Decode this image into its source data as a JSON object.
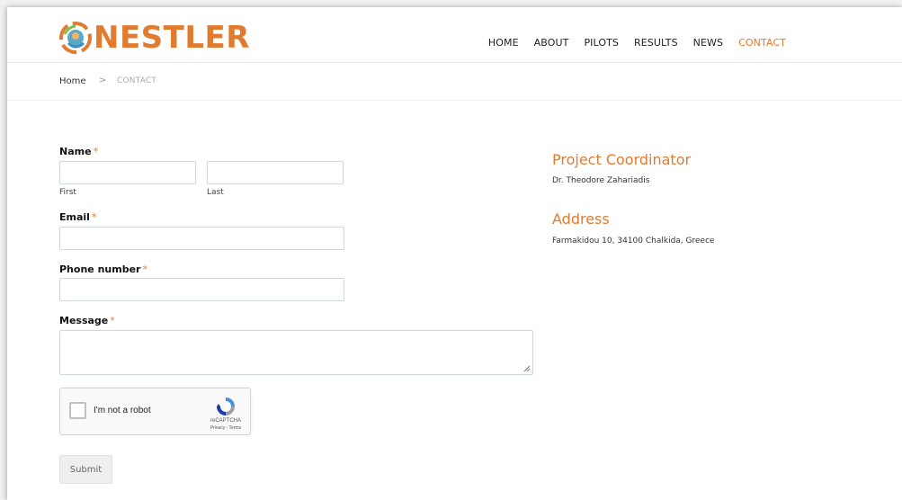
{
  "brand": {
    "name": "NESTLER",
    "logo_icon": "nestler-logo-icon",
    "accent_color": "#e07b2f"
  },
  "nav": {
    "items": [
      {
        "label": "HOME"
      },
      {
        "label": "ABOUT"
      },
      {
        "label": "PILOTS"
      },
      {
        "label": "RESULTS"
      },
      {
        "label": "NEWS"
      },
      {
        "label": "CONTACT",
        "active": true
      }
    ]
  },
  "breadcrumb": {
    "home": "Home",
    "separator": ">",
    "current": "CONTACT"
  },
  "form": {
    "name_label": "Name",
    "required_mark": "*",
    "first_label": "First",
    "last_label": "Last",
    "first_value": "",
    "last_value": "",
    "email_label": "Email",
    "email_value": "",
    "phone_label": "Phone number",
    "phone_value": "",
    "message_label": "Message",
    "message_value": "",
    "submit_label": "Submit"
  },
  "recaptcha": {
    "label": "I'm not a robot",
    "brand": "reCAPTCHA",
    "terms": "Privacy - Terms",
    "checked": false
  },
  "info": {
    "coordinator_title": "Project Coordinator",
    "coordinator_name": "Dr. Theodore Zahariadis",
    "address_title": "Address",
    "address_text": "Farmakidou 10, 34100 Chalkida, Greece"
  }
}
